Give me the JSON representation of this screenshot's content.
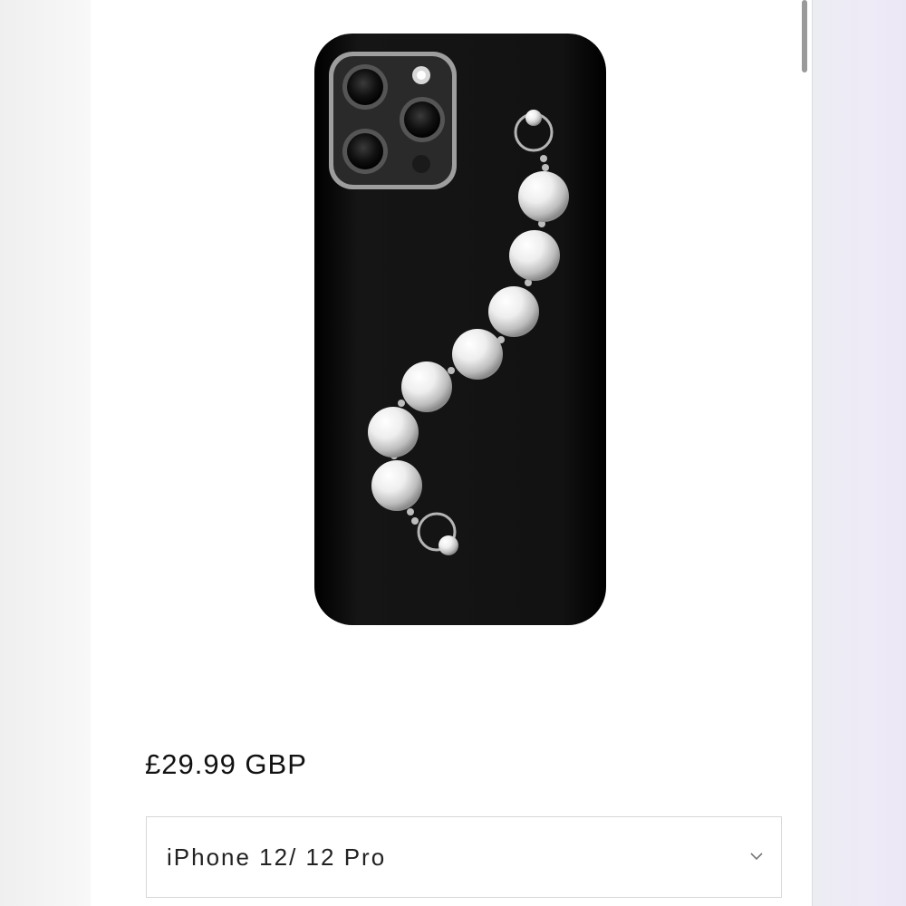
{
  "product": {
    "image_icon": "pearl-strap-phone-case-image",
    "case_color": "#0f0f0f",
    "accent_color": "#c9c9c9",
    "price": "£29.99 GBP"
  },
  "variant_select": {
    "selected": "iPhone 12/ 12 Pro",
    "icon": "chevron-down-icon"
  }
}
